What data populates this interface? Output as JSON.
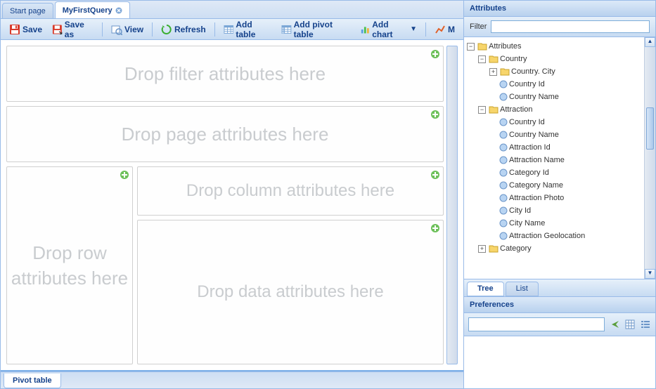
{
  "tabs": {
    "start": "Start page",
    "active": "MyFirstQuery"
  },
  "toolbar": {
    "save": "Save",
    "save_as": "Save as",
    "view": "View",
    "refresh": "Refresh",
    "add_table": "Add table",
    "add_pivot": "Add pivot table",
    "add_chart": "Add chart",
    "more": "M"
  },
  "drop": {
    "filter": "Drop filter attributes here",
    "page": "Drop page attributes here",
    "row": "Drop row attributes here",
    "column": "Drop column attributes here",
    "data": "Drop data attributes here"
  },
  "bottom_tab": "Pivot table",
  "right": {
    "attributes_title": "Attributes",
    "filter_label": "Filter",
    "tree": {
      "root": "Attributes",
      "country": {
        "label": "Country",
        "city": "Country. City",
        "id": "Country Id",
        "name": "Country Name"
      },
      "attraction": {
        "label": "Attraction",
        "items": [
          "Country Id",
          "Country Name",
          "Attraction Id",
          "Attraction Name",
          "Category Id",
          "Category Name",
          "Attraction Photo",
          "City Id",
          "City Name",
          "Attraction Geolocation"
        ]
      },
      "category": "Category"
    },
    "view_tabs": {
      "tree": "Tree",
      "list": "List"
    },
    "prefs_title": "Preferences"
  }
}
